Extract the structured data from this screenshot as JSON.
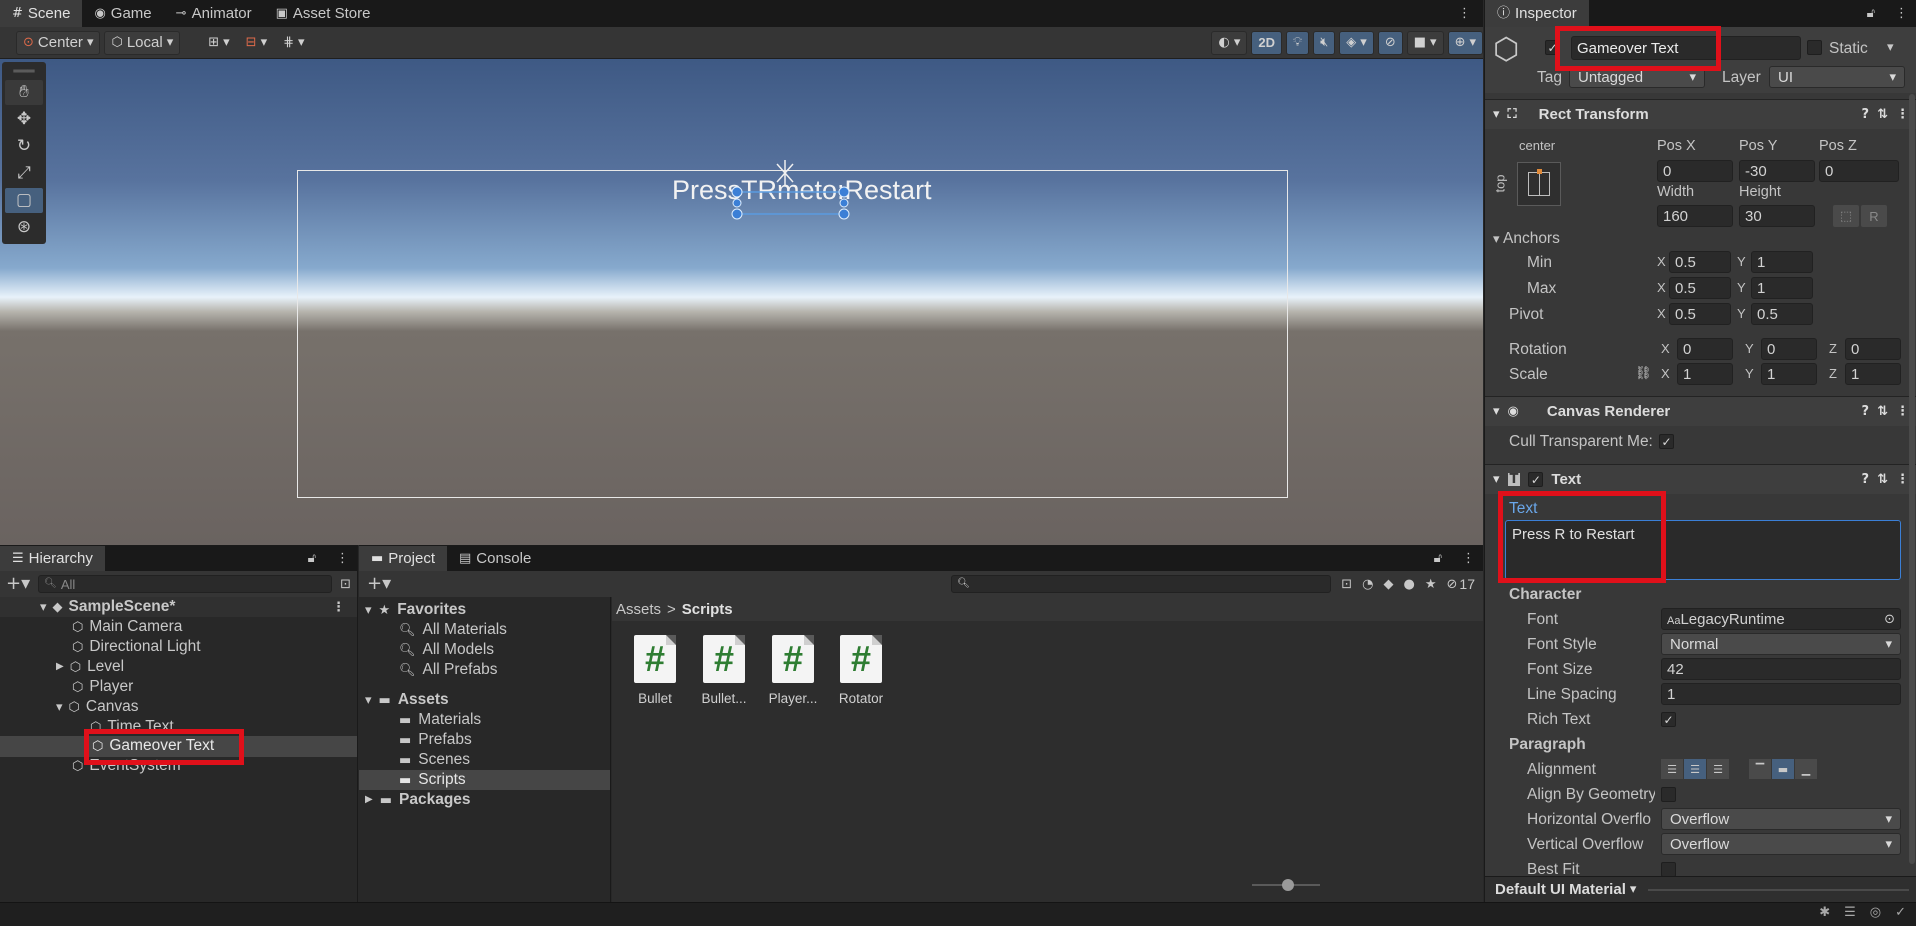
{
  "scene_tabs": [
    {
      "label": "Scene",
      "icon": "grid-icon"
    },
    {
      "label": "Game",
      "icon": "gamepad-icon"
    },
    {
      "label": "Animator",
      "icon": "animator-icon"
    },
    {
      "label": "Asset Store",
      "icon": "store-bag-icon"
    }
  ],
  "scene_toolbar": {
    "pivot_mode": "Center",
    "pivot_rotation": "Local",
    "mode_2d": "2D"
  },
  "scene_view": {
    "overlay_text": "PressTRmeto:Restart"
  },
  "hierarchy": {
    "tab": "Hierarchy",
    "search_placeholder": "All",
    "scene": "SampleScene*",
    "items": [
      "Main Camera",
      "Directional Light",
      "Level",
      "Player",
      "Canvas",
      "Time Text",
      "Gameover Text",
      "EventSystem"
    ]
  },
  "project": {
    "tab_project": "Project",
    "tab_console": "Console",
    "hidden_count": "17",
    "favorites": "Favorites",
    "fav_items": [
      "All Materials",
      "All Models",
      "All Prefabs"
    ],
    "assets": "Assets",
    "asset_folders": [
      "Materials",
      "Prefabs",
      "Scenes",
      "Scripts"
    ],
    "packages": "Packages",
    "breadcrumb_root": "Assets",
    "breadcrumb_sep": ">",
    "breadcrumb_current": "Scripts",
    "files": [
      "Bullet",
      "Bullet...",
      "Player...",
      "Rotator"
    ]
  },
  "inspector": {
    "tab": "Inspector",
    "object_name": "Gameover Text",
    "static_label": "Static",
    "tag_label": "Tag",
    "tag_value": "Untagged",
    "layer_label": "Layer",
    "layer_value": "UI",
    "rect_transform": {
      "title": "Rect Transform",
      "anchor_h": "center",
      "anchor_v": "top",
      "pos_x_label": "Pos X",
      "pos_y_label": "Pos Y",
      "pos_z_label": "Pos Z",
      "pos_x": "0",
      "pos_y": "-30",
      "pos_z": "0",
      "width_label": "Width",
      "height_label": "Height",
      "width": "160",
      "height": "30",
      "r_button": "R",
      "anchors_label": "Anchors",
      "min_label": "Min",
      "max_label": "Max",
      "min_x": "0.5",
      "min_y": "1",
      "max_x": "0.5",
      "max_y": "1",
      "pivot_label": "Pivot",
      "pivot_x": "0.5",
      "pivot_y": "0.5",
      "rotation_label": "Rotation",
      "rot_x": "0",
      "rot_y": "0",
      "rot_z": "0",
      "scale_label": "Scale",
      "scale_x": "1",
      "scale_y": "1",
      "scale_z": "1",
      "x": "X",
      "y": "Y",
      "z": "Z"
    },
    "canvas_renderer": {
      "title": "Canvas Renderer",
      "cull_label": "Cull Transparent Me:"
    },
    "text": {
      "title": "Text",
      "text_label": "Text",
      "text_value": "Press R to Restart",
      "character_label": "Character",
      "font_label": "Font",
      "font_value": "LegacyRuntime",
      "font_prefix": "Aa",
      "font_style_label": "Font Style",
      "font_style_value": "Normal",
      "font_size_label": "Font Size",
      "font_size_value": "42",
      "line_spacing_label": "Line Spacing",
      "line_spacing_value": "1",
      "rich_text_label": "Rich Text",
      "paragraph_label": "Paragraph",
      "alignment_label": "Alignment",
      "align_geometry_label": "Align By Geometry",
      "h_overflow_label": "Horizontal Overflo",
      "h_overflow_value": "Overflow",
      "v_overflow_label": "Vertical Overflow",
      "v_overflow_value": "Overflow",
      "best_fit_label": "Best Fit"
    },
    "material": "Default UI Material"
  },
  "colors": {
    "accent_blue": "#4a8ad4",
    "highlight_red": "#e0101a"
  }
}
